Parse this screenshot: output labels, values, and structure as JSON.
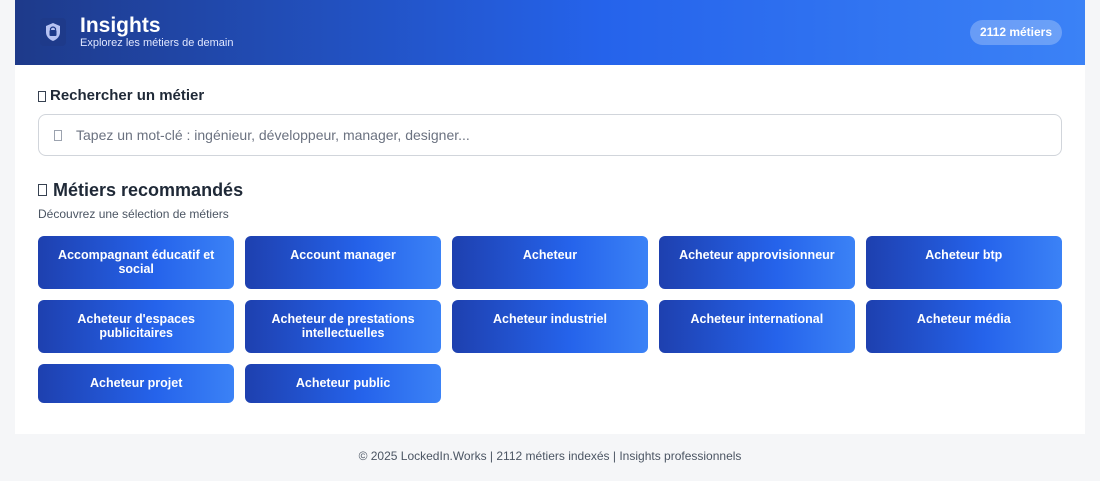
{
  "header": {
    "title": "Insights",
    "subtitle": "Explorez les métiers de demain",
    "count_badge": "2112 métiers",
    "logo_icon": "lock-shield-icon"
  },
  "search": {
    "heading": "Rechercher un métier",
    "placeholder": "Tapez un mot-clé : ingénieur, développeur, manager, designer...",
    "value": "",
    "icon": "missing-glyph-icon"
  },
  "recommended": {
    "heading": "Métiers recommandés",
    "subtitle": "Découvrez une sélection de métiers",
    "jobs": [
      "Accompagnant éducatif et social",
      "Account manager",
      "Acheteur",
      "Acheteur approvisionneur",
      "Acheteur btp",
      "Acheteur d'espaces publicitaires",
      "Acheteur de prestations intellectuelles",
      "Acheteur industriel",
      "Acheteur international",
      "Acheteur média",
      "Acheteur projet",
      "Acheteur public"
    ]
  },
  "footer": {
    "text": "© 2025 LockedIn.Works | 2112 métiers indexés | Insights professionnels"
  },
  "colors": {
    "header_start": "#1e3a8a",
    "header_end": "#3b82f6",
    "card_start": "#1e40af",
    "card_end": "#3b82f6",
    "background": "#f5f6f8"
  }
}
